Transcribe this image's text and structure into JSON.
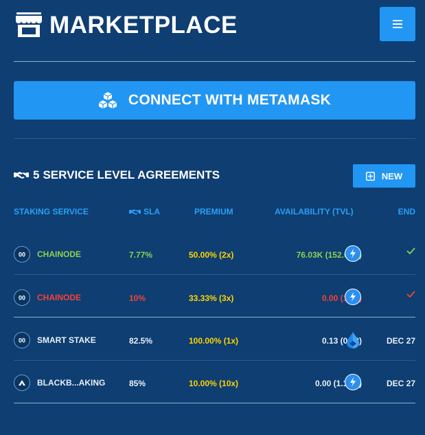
{
  "header": {
    "title": "MARKETPLACE",
    "logo_icon": "store-icon",
    "menu_icon": "hamburger-menu-icon"
  },
  "connect": {
    "label": "CONNECT WITH METAMASK",
    "icon": "cubes-icon"
  },
  "section": {
    "count": "5",
    "title": "SERVICE LEVEL AGREEMENTS",
    "new_label": "NEW"
  },
  "table": {
    "columns": {
      "service": "STAKING SERVICE",
      "sla": "SLA",
      "premium": "PREMIUM",
      "availability": "AVAILABILITY (TVL)",
      "end": "END"
    },
    "rows": [
      {
        "service": "CHAINODE",
        "sla": "7.77%",
        "premium": "50.00% (2x)",
        "availability": "76.03K (152.05K)",
        "avail_icon": "bolt-icon",
        "end": "",
        "end_icon": "check-icon",
        "status": "green"
      },
      {
        "service": "CHAINODE",
        "sla": "10%",
        "premium": "33.33% (3x)",
        "availability": "0.00 (1.33)",
        "avail_icon": "bolt-icon",
        "end": "",
        "end_icon": "check-icon",
        "status": "red"
      },
      {
        "service": "SMART STAKE",
        "sla": "82.5%",
        "premium": "100.00% (1x)",
        "availability": "0.13 (0.13)",
        "avail_icon": "droplet-icon",
        "end": "DEC 27",
        "end_icon": "",
        "status": "white"
      },
      {
        "service": "BLACKB...AKING",
        "sla": "85%",
        "premium": "10.00% (10x)",
        "availability": "0.00 (1.10M)",
        "avail_icon": "bolt-icon",
        "end": "DEC 27",
        "end_icon": "",
        "status": "white"
      }
    ]
  },
  "colors": {
    "background": "#0e3e72",
    "accent": "#2296f3",
    "header_text": "#2ba0f5",
    "premium": "#ffd400",
    "positive": "#8fd14f",
    "negative": "#f44336"
  }
}
